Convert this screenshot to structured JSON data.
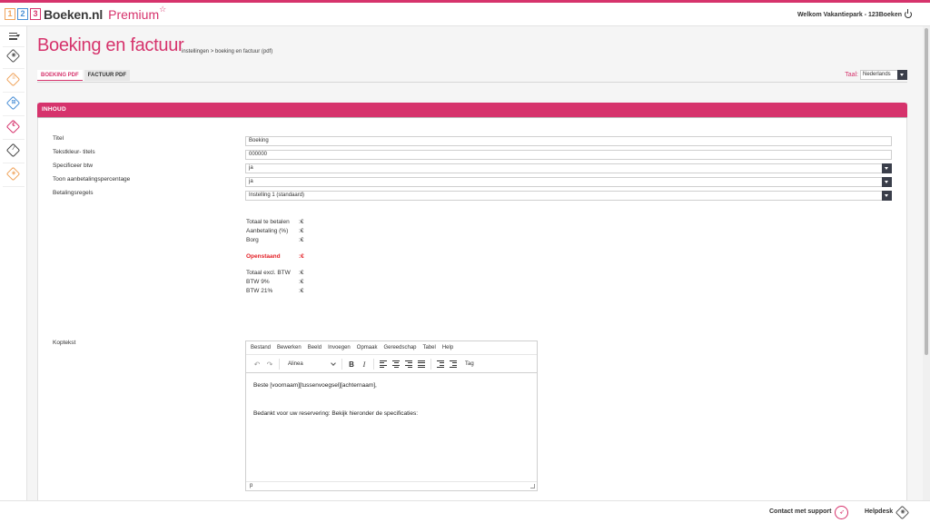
{
  "header": {
    "logo_digits": [
      "1",
      "2",
      "3"
    ],
    "brand": "Boeken.nl",
    "premium": "Premium",
    "star": "☆",
    "welcome": "Welkom Vakantiepark - 123Boeken"
  },
  "page": {
    "title": "Boeking en factuur",
    "breadcrumb": "instellingen > boeking en factuur (pdf)"
  },
  "tabs": [
    {
      "label": "BOEKING PDF",
      "active": true
    },
    {
      "label": "FACTUUR PDF",
      "active": false
    }
  ],
  "language": {
    "label": "Taal:",
    "value": "Nederlands"
  },
  "panel": {
    "title": "INHOUD"
  },
  "form": {
    "titel": {
      "label": "Titel",
      "value": "Boeking"
    },
    "tekstkleur": {
      "label": "Tekstkleur- titels",
      "value": "000000"
    },
    "btw": {
      "label": "Specificeer btw",
      "value": "ja"
    },
    "aanbetaling": {
      "label": "Toon aanbetalingspercentage",
      "value": "ja"
    },
    "betalingsregels": {
      "label": "Betalingsregels",
      "value": "Instelling 1 (standaard)"
    },
    "koptekst": {
      "label": "Koptekst"
    }
  },
  "summary": {
    "totaal": {
      "label": "Totaal te betalen",
      "value": ":€"
    },
    "aanbetaling": {
      "label": "Aanbetaling (%)",
      "value": ":€"
    },
    "borg": {
      "label": "Borg",
      "value": ":€"
    },
    "openstaand": {
      "label": "Openstaand",
      "value": ":€"
    },
    "excl": {
      "label": "Totaal excl. BTW",
      "value": ":€"
    },
    "btw9": {
      "label": "BTW 9%",
      "value": ":€"
    },
    "btw21": {
      "label": "BTW 21%",
      "value": ":€"
    }
  },
  "editor": {
    "menu": [
      "Bestand",
      "Bewerken",
      "Beeld",
      "Invoegen",
      "Opmaak",
      "Gereedschap",
      "Tabel",
      "Help"
    ],
    "format": "Alinea",
    "bold": "B",
    "italic": "I",
    "tag": "Tag",
    "content": [
      "Beste [voornaam][tussenvoegsel][achternaam],",
      "Bedankt voor uw reservering: Bekijk hieronder de specificaties:"
    ],
    "status": "p"
  },
  "footer": {
    "support": "Contact met support",
    "helpdesk": "Helpdesk"
  },
  "colors": {
    "accent": "#d6336c",
    "dark": "#3a3e4a",
    "alert": "#e31e24"
  }
}
